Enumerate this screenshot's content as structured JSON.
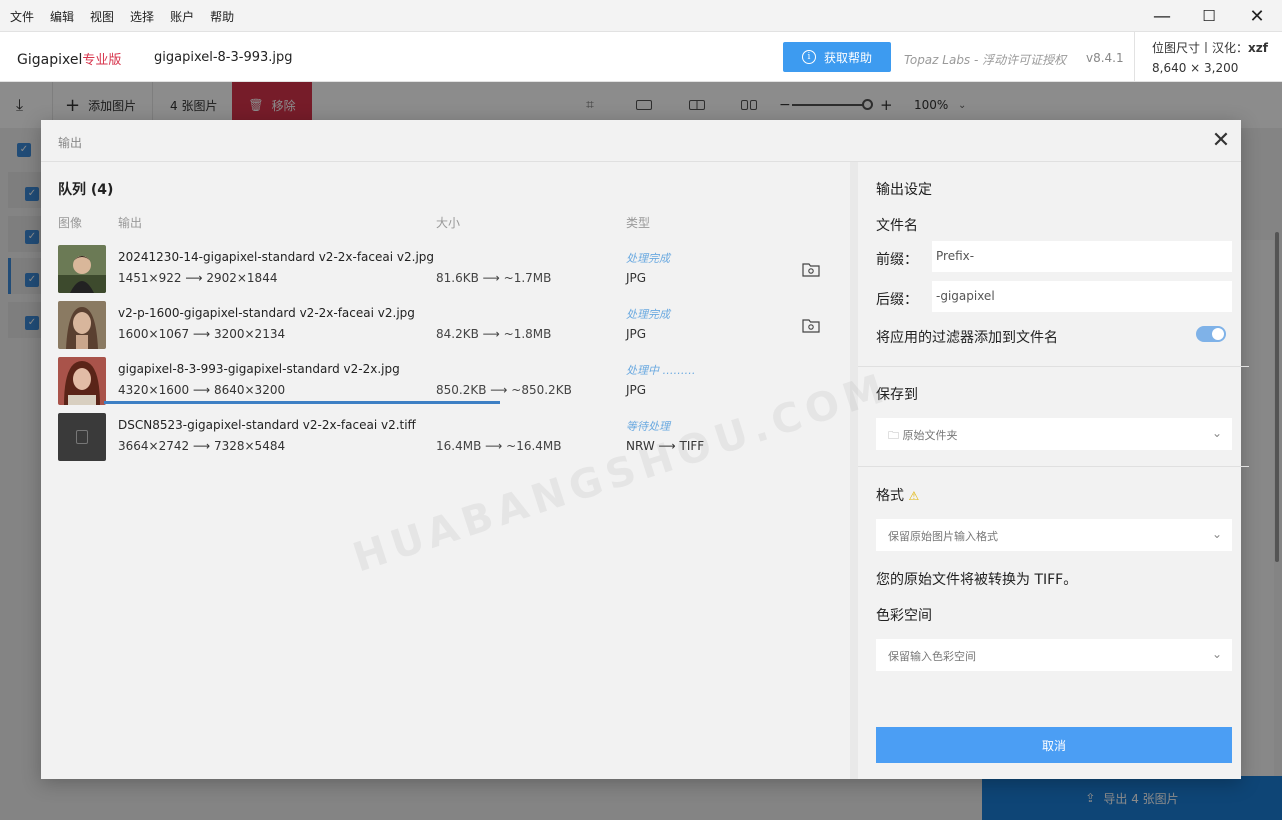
{
  "menubar": {
    "items": [
      "文件",
      "编辑",
      "视图",
      "选择",
      "账户",
      "帮助"
    ]
  },
  "window_controls": {
    "minimize": "—",
    "maximize": "☐",
    "close": "✕"
  },
  "header": {
    "brand": "Gigapixel",
    "brand_pro": "专业版",
    "filename": "gigapixel-8-3-993.jpg",
    "help_button": "获取帮助",
    "license": "Topaz Labs - 浮动许可证授权",
    "version": "v8.4.1",
    "image_size_label": "位图尺寸丨汉化：",
    "translator": "xzf",
    "image_size_value": "8,640 × 3,200"
  },
  "toolbar": {
    "add_images": "添加图片",
    "image_count": "4 张图片",
    "remove": "移除",
    "zoom_value": "100%",
    "zoom_minus": "−",
    "zoom_plus": "+"
  },
  "export_button": "导出 4 张图片",
  "dialog": {
    "title": "输出",
    "queue": {
      "title": "队列 (4)",
      "headers": {
        "image": "图像",
        "output": "输出",
        "size": "大小",
        "type": "类型"
      },
      "rows": [
        {
          "filename": "20241230-14-gigapixel-standard v2-2x-faceai v2.jpg",
          "dims": "1451×922 ⟶ 2902×1844",
          "size": "81.6KB ⟶ ~1.7MB",
          "status": "处理完成",
          "type": "JPG",
          "thumb_color": "#5a6b4a"
        },
        {
          "filename": "v2-p-1600-gigapixel-standard v2-2x-faceai v2.jpg",
          "dims": "1600×1067 ⟶ 3200×2134",
          "size": "84.2KB ⟶ ~1.8MB",
          "status": "处理完成",
          "type": "JPG",
          "thumb_color": "#7a6a58"
        },
        {
          "filename": "gigapixel-8-3-993-gigapixel-standard v2-2x.jpg",
          "dims": "4320×1600 ⟶ 8640×3200",
          "size": "850.2KB ⟶ ~850.2KB",
          "status": "处理中 ………",
          "type": "JPG",
          "thumb_color": "#a65a4a",
          "progress": 0.4
        },
        {
          "filename": "DSCN8523-gigapixel-standard v2-2x-faceai v2.tiff",
          "dims": "3664×2742 ⟶ 7328×5484",
          "size": "16.4MB ⟶ ~16.4MB",
          "status": "等待处理",
          "type": "NRW ⟶ TIFF",
          "thumb_color": "#3a3a3a"
        }
      ]
    },
    "settings": {
      "title": "输出设定",
      "filename_title": "文件名",
      "prefix_label": "前缀：",
      "prefix_value": "Prefix-",
      "suffix_label": "后缀：",
      "suffix_value": "-gigapixel",
      "append_filters_label": "将应用的过滤器添加到文件名",
      "append_filters_on": true,
      "save_to_title": "保存到",
      "save_to_value": "原始文件夹",
      "format_title": "格式",
      "format_warning": "⚠",
      "format_value": "保留原始图片输入格式",
      "format_note": "您的原始文件将被转换为 TIFF。",
      "color_space_title": "色彩空间",
      "color_space_value": "保留输入色彩空间",
      "cancel": "取消"
    }
  },
  "watermark": "HUABANGSHOU.COM",
  "colors": {
    "accent": "#3d9bf0",
    "remove_red": "#d7344c",
    "status_blue": "#6aa9e0",
    "progress": "#3d7fc4",
    "export_blue": "#1b7fd8"
  }
}
